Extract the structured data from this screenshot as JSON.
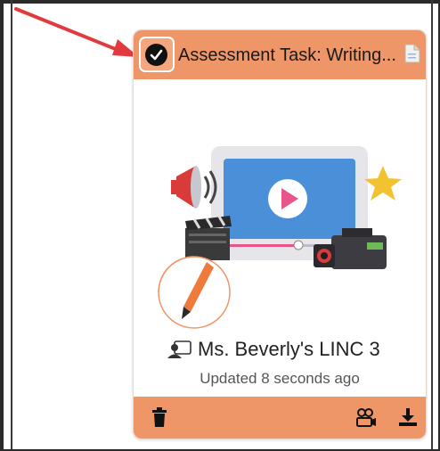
{
  "card": {
    "title": "Assessment Task: Writing...",
    "selected": true,
    "owner_name": "Ms. Beverly's LINC 3",
    "updated_text": "Updated 8 seconds ago"
  },
  "colors": {
    "card_header": "#ef9668",
    "card_footer": "#ef9668",
    "arrow": "#e23b3f",
    "screen_blue": "#4a90d9",
    "play_button": "#e8558a",
    "star": "#f2c230"
  },
  "icons": {
    "select": "check-circle-icon",
    "title_suffix": "document-icon",
    "owner": "person-screen-icon",
    "delete": "trash-icon",
    "share": "camera-share-icon",
    "download": "download-icon",
    "illustration": "video-production-illustration",
    "badge": "pencil-badge-icon"
  }
}
